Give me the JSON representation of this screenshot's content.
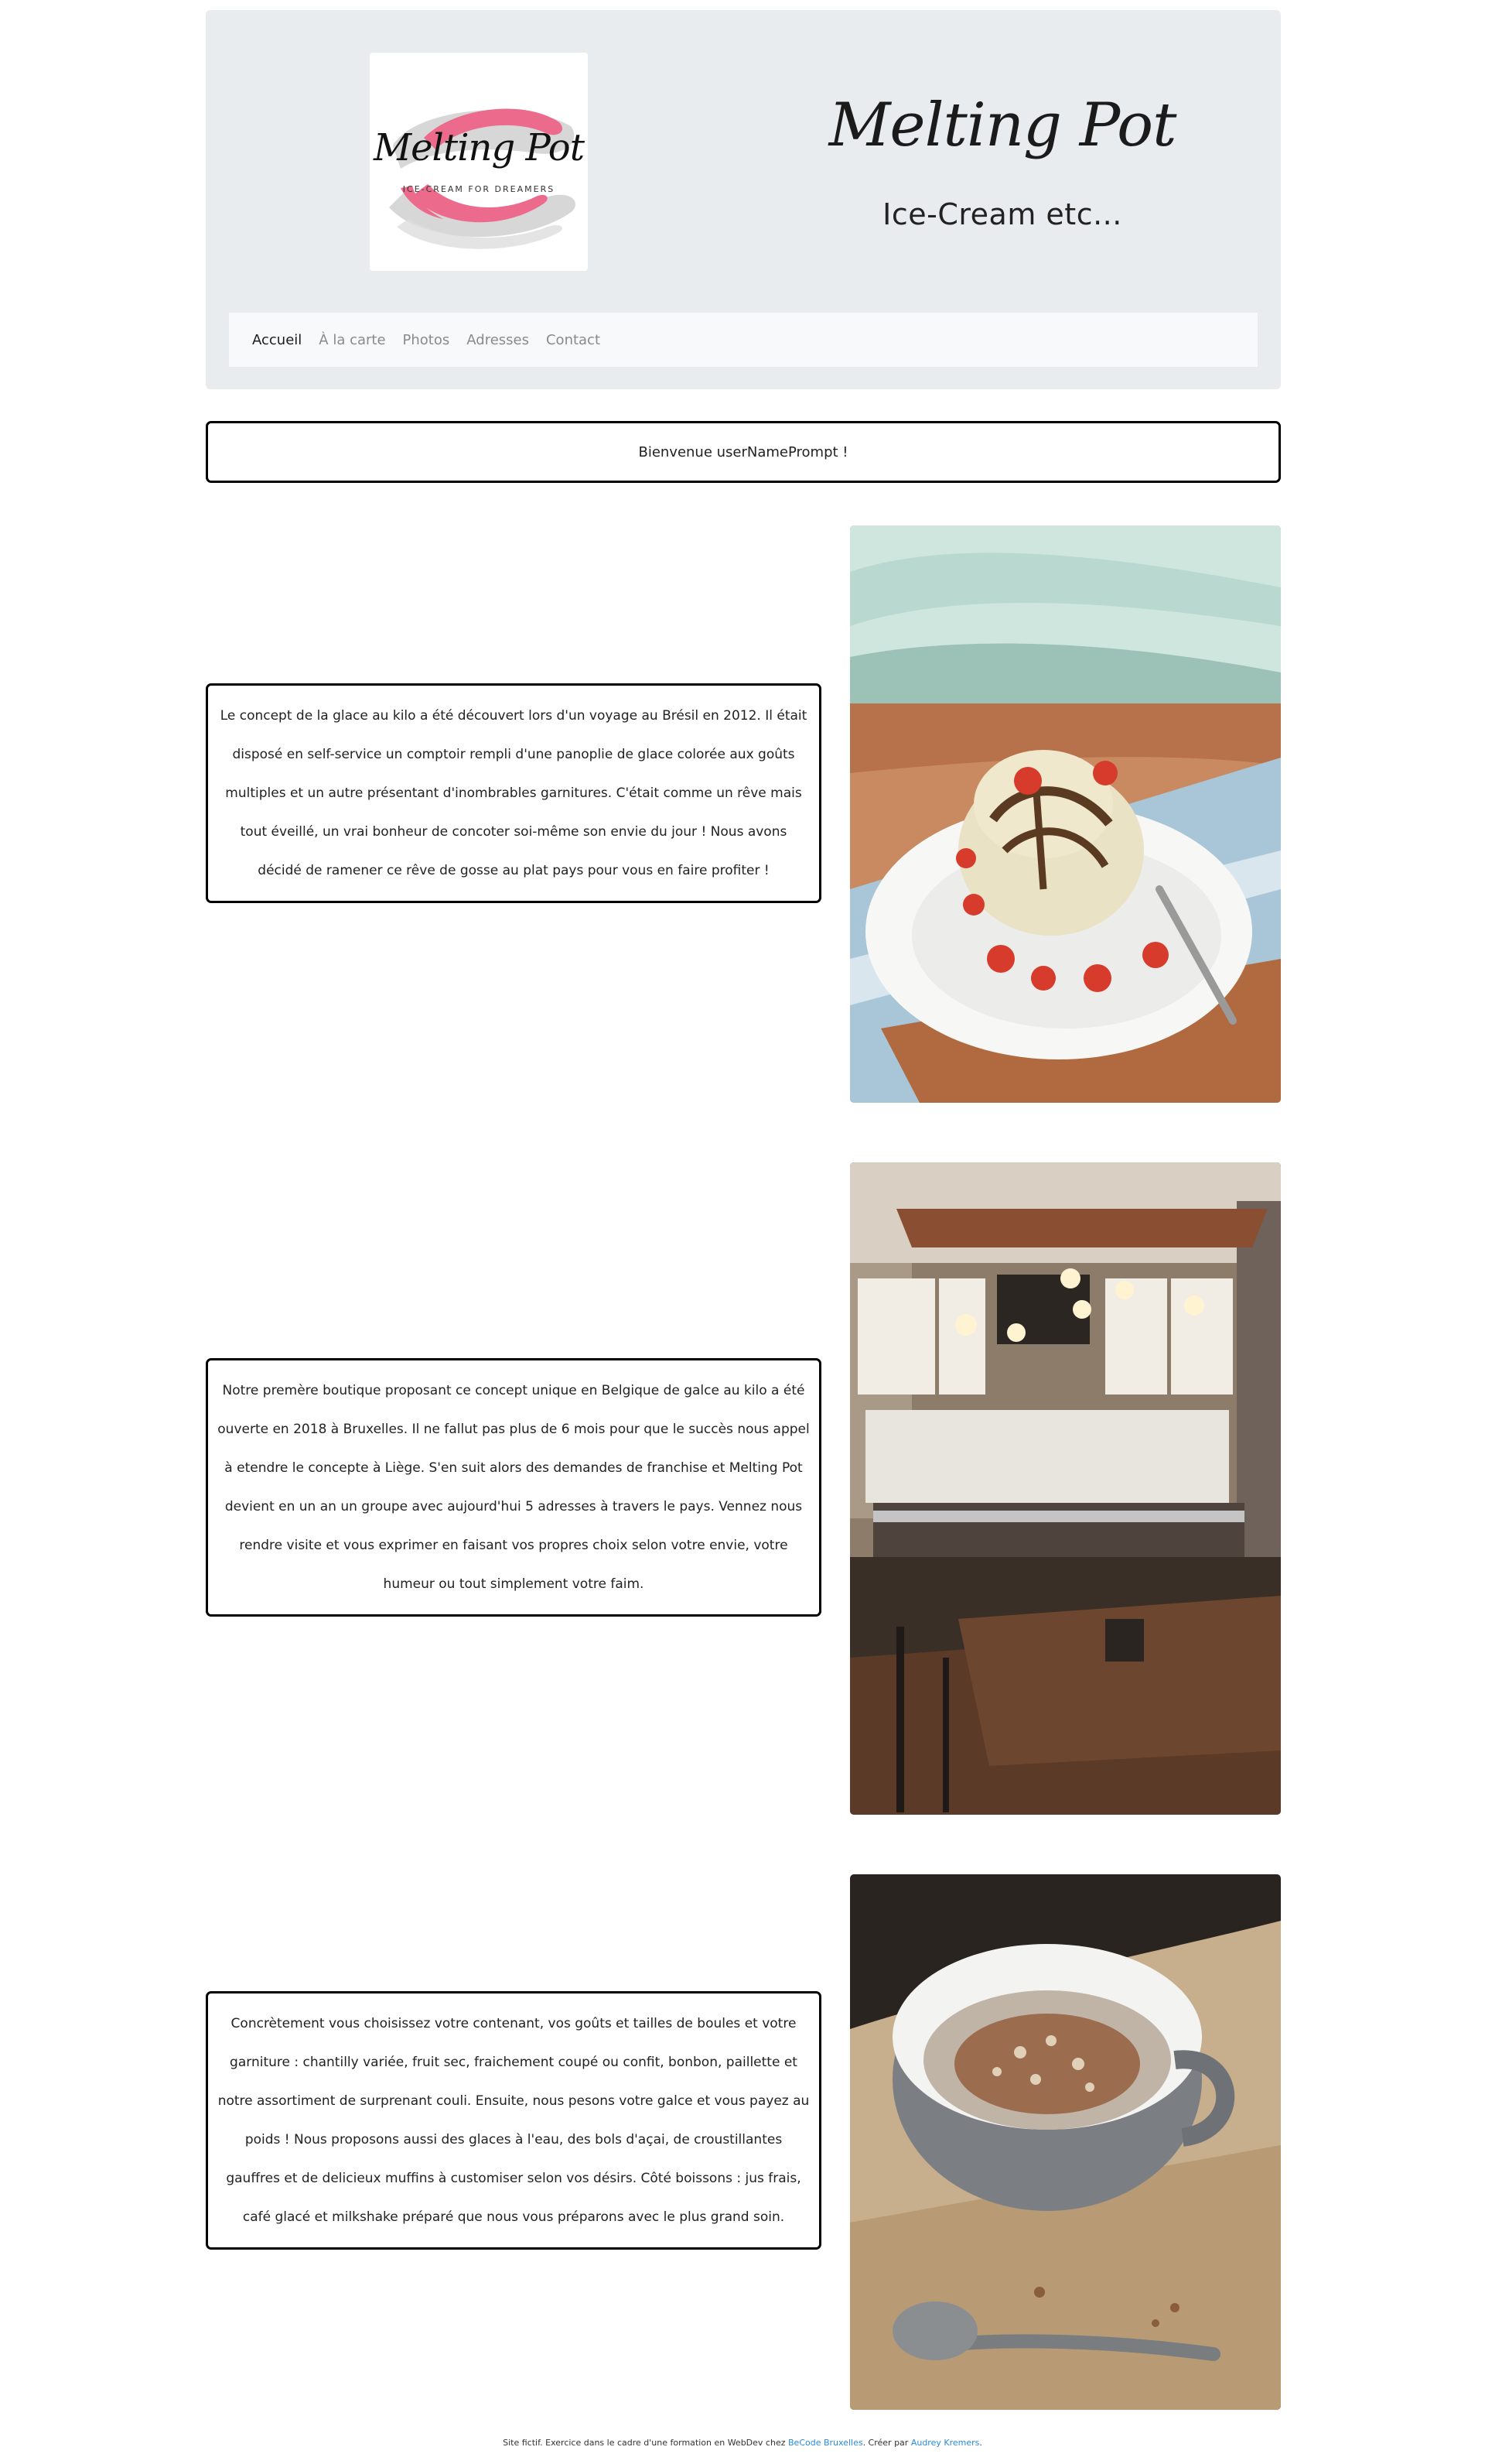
{
  "header": {
    "logo": {
      "brand": "Melting Pot",
      "tagline": "ICE-CREAM FOR DREAMERS"
    },
    "title": "Melting Pot",
    "subtitle": "Ice-Cream etc...",
    "nav": [
      {
        "label": "Accueil",
        "active": true
      },
      {
        "label": "À la carte",
        "active": false
      },
      {
        "label": "Photos",
        "active": false
      },
      {
        "label": "Adresses",
        "active": false
      },
      {
        "label": "Contact",
        "active": false
      }
    ]
  },
  "welcome": "Bienvenue userNamePrompt !",
  "sections": [
    {
      "text": "Le concept de la glace au kilo a été découvert lors d'un voyage au Brésil en 2012. Il était disposé en self-service un comptoir rempli d'une panoplie de glace colorée aux goûts multiples et un autre présentant d'inombrables garnitures. C'était comme un rêve mais tout éveillé, un vrai bonheur de concoter soi-même son envie du jour ! Nous avons décidé de ramener ce rêve de gosse au plat pays pour vous en faire profiter !",
      "image": "ice-cream-sundae-photo"
    },
    {
      "text": "Notre premère boutique proposant ce concept unique en Belgique de galce au kilo a été ouverte en 2018 à Bruxelles. Il ne fallut pas plus de 6 mois pour que le succès nous appel à etendre le concepte à Liège. S'en suit alors des demandes de franchise et Melting Pot devient en un an un groupe avec aujourd'hui 5 adresses à travers le pays. Vennez nous rendre visite et vous exprimer en faisant vos propres choix selon votre envie, votre humeur ou tout simplement votre faim.",
      "image": "cafe-interior-photo"
    },
    {
      "text": "Concrètement vous choisissez votre contenant, vos goûts et tailles de boules et votre garniture : chantilly variée, fruit sec, fraichement coupé ou confit, bonbon, paillette et notre assortiment de surprenant couli. Ensuite, nous pesons votre galce et vous payez au poids ! Nous proposons aussi des glaces à l'eau, des bols d'açai, de croustillantes gauffres et de delicieux muffins à customiser selon vos désirs. Côté boissons : jus frais, café glacé et milkshake préparé que nous vous préparons avec le plus grand soin.",
      "image": "granola-bowl-photo"
    }
  ],
  "footer": {
    "prefix": "Site fictif. Exercice dans le cadre d'une formation en WebDev chez",
    "link1": "BeCode Bruxelles",
    "middle": ". Créer par",
    "link2": "Audrey Kremers",
    "suffix": "."
  },
  "colors": {
    "header_bg": "#e9ecef",
    "nav_bg": "#f8f9fa",
    "logo_pink": "#ec6b8c",
    "link": "#2a8bd6"
  }
}
